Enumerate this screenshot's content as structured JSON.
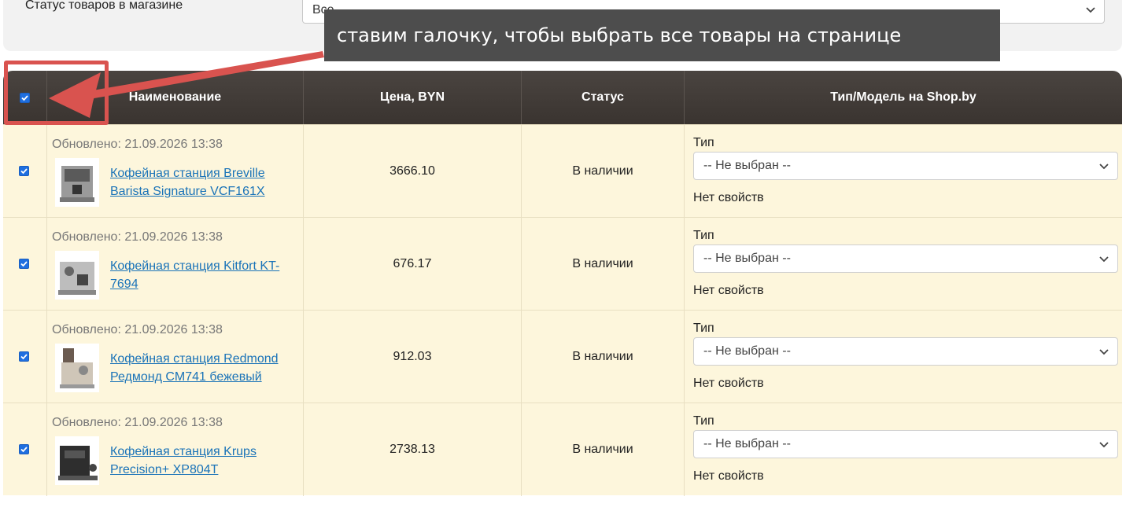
{
  "filter": {
    "label": "Статус товаров в магазине",
    "selected": "Все"
  },
  "table": {
    "headers": [
      "Наименование",
      "Цена, BYN",
      "Статус",
      "Тип/Модель на Shop.by"
    ],
    "select_all_checked": true,
    "rows": [
      {
        "updated": "Обновлено: 21.09.2026 13:38",
        "name": "Кофейная станция Breville Barista Signature VCF161X",
        "price": "3666.10",
        "status": "В наличии",
        "type_label": "Тип",
        "type_value": "-- Не выбран --",
        "props": "Нет свойств",
        "checked": true
      },
      {
        "updated": "Обновлено: 21.09.2026 13:38",
        "name": "Кофейная станция Kitfort KT-7694",
        "price": "676.17",
        "status": "В наличии",
        "type_label": "Тип",
        "type_value": "-- Не выбран --",
        "props": "Нет свойств",
        "checked": true
      },
      {
        "updated": "Обновлено: 21.09.2026 13:38",
        "name": "Кофейная станция Redmond Редмонд CM741 бежевый",
        "price": "912.03",
        "status": "В наличии",
        "type_label": "Тип",
        "type_value": "-- Не выбран --",
        "props": "Нет свойств",
        "checked": true
      },
      {
        "updated": "Обновлено: 21.09.2026 13:38",
        "name": "Кофейная станция Krups Precision+ XP804T",
        "price": "2738.13",
        "status": "В наличии",
        "type_label": "Тип",
        "type_value": "-- Не выбран --",
        "props": "Нет свойств",
        "checked": true
      }
    ]
  },
  "annotation": {
    "text": "ставим галочку, чтобы выбрать все товары на странице",
    "color": "#d9534f"
  },
  "colors": {
    "header_bg": "#3f3935",
    "row_bg": "#fdf6dc",
    "link": "#1a73b8",
    "checkbox": "#1f6fe0"
  }
}
